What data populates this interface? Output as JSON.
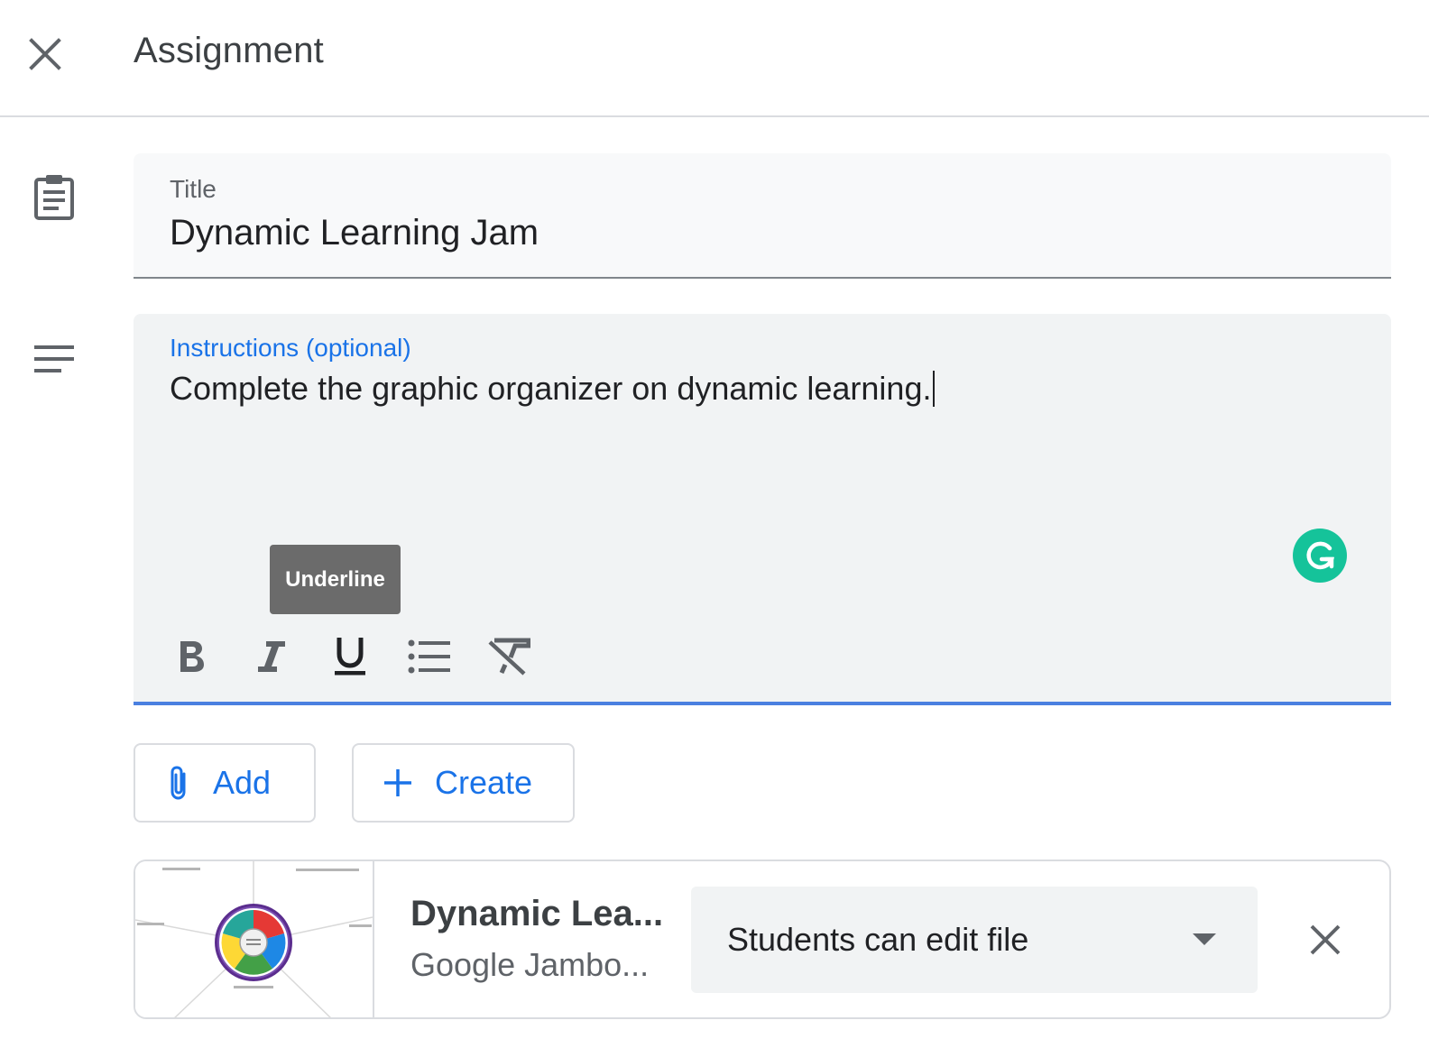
{
  "header": {
    "title": "Assignment",
    "close_icon": "close-icon"
  },
  "title_field": {
    "label": "Title",
    "value": "Dynamic Learning Jam",
    "icon": "assignment-clipboard-icon"
  },
  "instructions_field": {
    "label": "Instructions (optional)",
    "value": "Complete the graphic organizer on dynamic learning.",
    "icon": "notes-lines-icon",
    "focused": true,
    "focus_color": "#4a80e0"
  },
  "tooltip": {
    "text": "Underline"
  },
  "format_toolbar": {
    "items": [
      {
        "name": "bold",
        "icon": "bold-icon"
      },
      {
        "name": "italic",
        "icon": "italic-icon"
      },
      {
        "name": "underline",
        "icon": "underline-icon"
      },
      {
        "name": "bulleted-list",
        "icon": "bulleted-list-icon"
      },
      {
        "name": "clear-formatting",
        "icon": "clear-formatting-icon"
      }
    ]
  },
  "grammarly": {
    "icon": "grammarly-icon",
    "color": "#15c39a"
  },
  "actions": {
    "add_label": "Add",
    "add_icon": "paperclip-icon",
    "create_label": "Create",
    "create_icon": "plus-icon",
    "accent": "#1a73e8"
  },
  "attachment": {
    "title": "Dynamic Lea...",
    "subtitle": "Google Jambo...",
    "permission": "Students can edit file",
    "dropdown_icon": "dropdown-arrow-icon",
    "remove_icon": "close-icon"
  }
}
